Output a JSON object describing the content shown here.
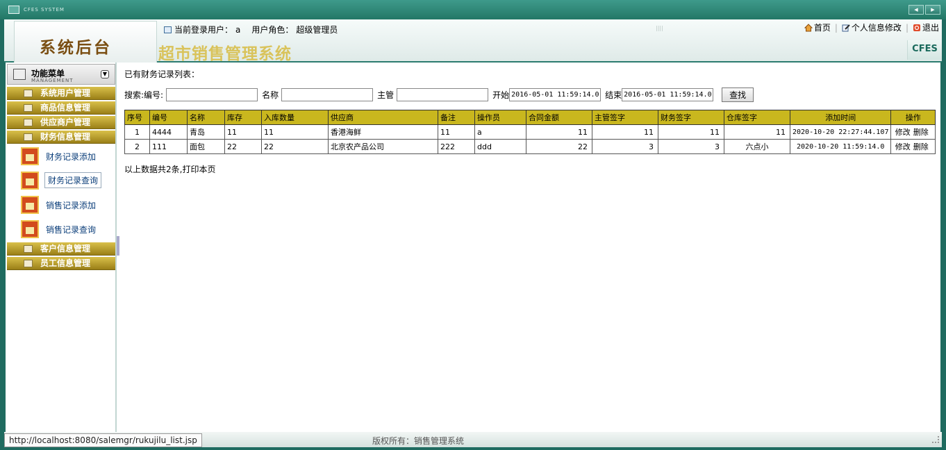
{
  "window": {
    "title": "CFES SYSTEM"
  },
  "header": {
    "logo_text": "系统后台",
    "system_title": "超市销售管理系统",
    "brand": "CFES",
    "login_label": "当前登录用户：",
    "login_user": "a",
    "role_label": "用户角色：",
    "role_value": "超级管理员",
    "links": {
      "home": "首页",
      "profile": "个人信息修改",
      "logout": "退出"
    }
  },
  "sidebar": {
    "title": "功能菜单",
    "subtitle": "MANAGEMENT",
    "categories": [
      {
        "label": "系统用户管理"
      },
      {
        "label": "商品信息管理"
      },
      {
        "label": "供应商户管理"
      },
      {
        "label": "财务信息管理"
      },
      {
        "label": "客户信息管理"
      },
      {
        "label": "员工信息管理"
      }
    ],
    "subitems": [
      {
        "label": "财务记录添加"
      },
      {
        "label": "财务记录查询"
      },
      {
        "label": "销售记录添加"
      },
      {
        "label": "销售记录查询"
      }
    ]
  },
  "main": {
    "heading": "已有财务记录列表：",
    "search": {
      "code_label": "搜索:编号:",
      "name_label": "名称",
      "manager_label": "主管",
      "start_label": "开始",
      "start_value": "2016-05-01 11:59:14.0",
      "end_label": "结束",
      "end_value": "2016-05-01 11:59:14.0",
      "button": "查找"
    },
    "table": {
      "headers": [
        "序号",
        "编号",
        "名称",
        "库存",
        "入库数量",
        "供应商",
        "备注",
        "操作员",
        "合同金额",
        "主管签字",
        "财务签字",
        "仓库签字",
        "添加时间",
        "操作"
      ],
      "rows": [
        {
          "seq": "1",
          "code": "4444",
          "name": "青岛",
          "stock": "11",
          "qty": "11",
          "supplier": "香港海鲜",
          "note": "11",
          "operator": "a",
          "amount": "11",
          "manager_sign": "11",
          "finance_sign": "11",
          "warehouse_sign": "11",
          "time": "2020-10-20 22:27:44.107",
          "edit": "修改",
          "del": "删除"
        },
        {
          "seq": "2",
          "code": "111",
          "name": "面包",
          "stock": "22",
          "qty": "22",
          "supplier": "北京农产品公司",
          "note": "222",
          "operator": "ddd",
          "amount": "22",
          "manager_sign": "3",
          "finance_sign": "3",
          "warehouse_sign": "六点小",
          "time": "2020-10-20 11:59:14.0",
          "edit": "修改",
          "del": "删除"
        }
      ]
    },
    "summary": "以上数据共2条,打印本页"
  },
  "footer": {
    "status_url": "http://localhost:8080/salemgr/rukujilu_list.jsp",
    "copyright": "版权所有：销售管理系统"
  }
}
